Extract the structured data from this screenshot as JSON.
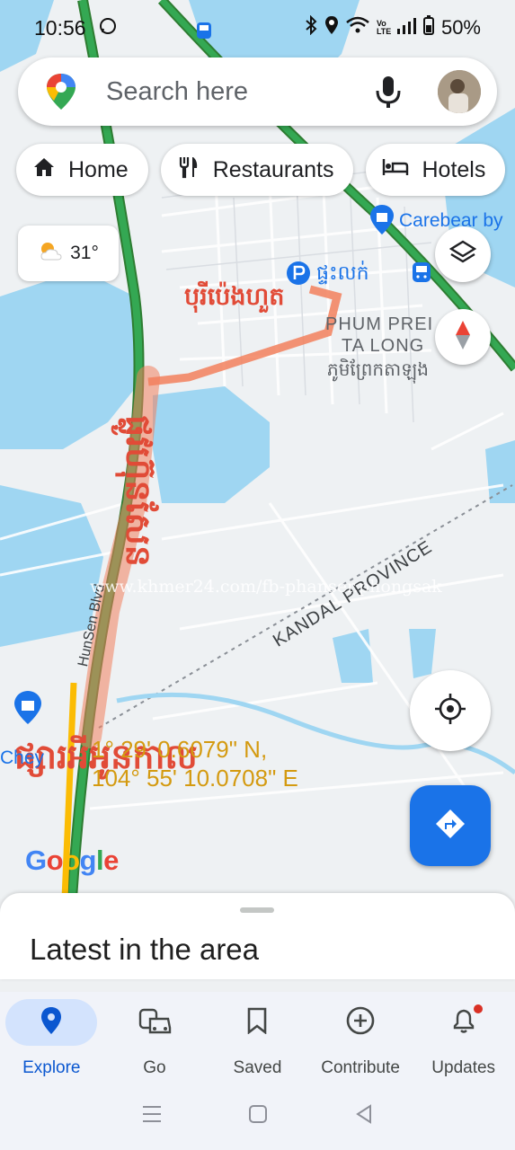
{
  "status_bar": {
    "time": "10:56",
    "battery": "50%",
    "volte_label": "Vo LTE"
  },
  "search": {
    "placeholder": "Search here"
  },
  "chips": [
    {
      "label": "Home",
      "icon": "home-icon"
    },
    {
      "label": "Restaurants",
      "icon": "restaurant-icon"
    },
    {
      "label": "Hotels",
      "icon": "hotel-icon"
    }
  ],
  "weather": {
    "temperature": "31°",
    "icon": "partly-sunny-icon"
  },
  "map": {
    "place_pin_label": "ផ្ទះលក់",
    "carebear_label": "Carebear by",
    "handwritten_top": "បុរីប៉េងហួត",
    "area_en_1": "PHUM PREI",
    "area_en_2": "TA LONG",
    "area_km": "ភូមិព្រែកតាឡុង",
    "road_label": "HunSen Blvd",
    "province_label": "KANDAL PROVINCE",
    "handwritten_vertical": "ផ្លូវហ៊ុនសែន",
    "handwritten_bottom": "ផ្សារអីអូនកាល",
    "left_poi_label": "Chey",
    "watermark": "www.khmer24.com/fb-phanser.phongsak",
    "coords_line1": "1° 29' 0.6079\" N,",
    "coords_line2": "104° 55' 10.0708\" E",
    "google_logo": "Google",
    "road_color": "#34a853",
    "route_color": "#f2805c",
    "water_color": "#9fd6f2"
  },
  "sheet": {
    "title": "Latest in the area"
  },
  "bottom_nav": [
    {
      "label": "Explore",
      "icon": "explore-pin-icon",
      "active": true
    },
    {
      "label": "Go",
      "icon": "car-icon",
      "active": false
    },
    {
      "label": "Saved",
      "icon": "bookmark-icon",
      "active": false
    },
    {
      "label": "Contribute",
      "icon": "add-circle-icon",
      "active": false
    },
    {
      "label": "Updates",
      "icon": "bell-icon",
      "active": false
    }
  ],
  "colors": {
    "accent": "#1a73e8",
    "active_nav_bg": "#d3e3fd"
  }
}
